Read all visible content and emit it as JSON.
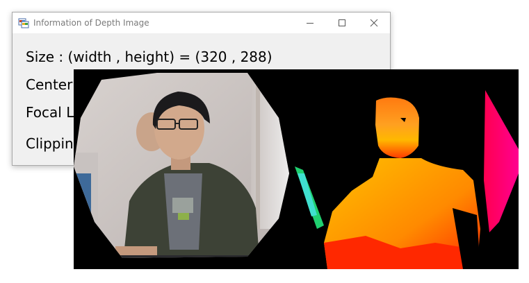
{
  "window": {
    "title": "Information of Depth Image",
    "icon": "app-window-icon"
  },
  "info": {
    "size_line": "Size : (width , height) = (320 , 288)",
    "center_line": "Center",
    "focal_line": "Focal L",
    "clipping_line": "Clipping"
  },
  "image_panel": {
    "left_image": "color-camera-image-of-person",
    "right_image": "depth-map-pseudocolor-image"
  },
  "colors": {
    "dialog_bg": "#f0f0f0",
    "titlebar_bg": "#ffffff",
    "title_text": "#7a7a7a",
    "panel_bg": "#000000"
  }
}
